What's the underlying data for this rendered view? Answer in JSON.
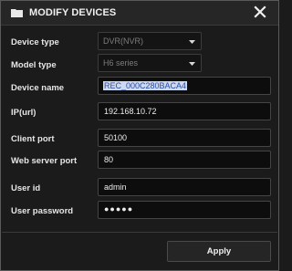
{
  "dialog": {
    "title": "MODIFY DEVICES"
  },
  "fields": {
    "device_type": {
      "label": "Device type",
      "value": "DVR(NVR)"
    },
    "model_type": {
      "label": "Model type",
      "value": "H6 series"
    },
    "device_name": {
      "label": "Device name",
      "value": "REC_000C280BACA4"
    },
    "ip": {
      "label": "IP(url)",
      "value": "192.168.10.72"
    },
    "client_port": {
      "label": "Client port",
      "value": "50100"
    },
    "web_port": {
      "label": "Web server port",
      "value": "80"
    },
    "user_id": {
      "label": "User id",
      "value": "admin"
    },
    "password": {
      "label": "User password",
      "value": "●●●●●"
    }
  },
  "buttons": {
    "apply": "Apply"
  },
  "icons": {
    "title": "folder-icon",
    "close": "close-icon",
    "dropdown": "chevron-down-icon"
  },
  "colors": {
    "selection_bg": "#cdd9f0",
    "selection_text": "#2a4da8",
    "panel": "#1b1b1b"
  }
}
